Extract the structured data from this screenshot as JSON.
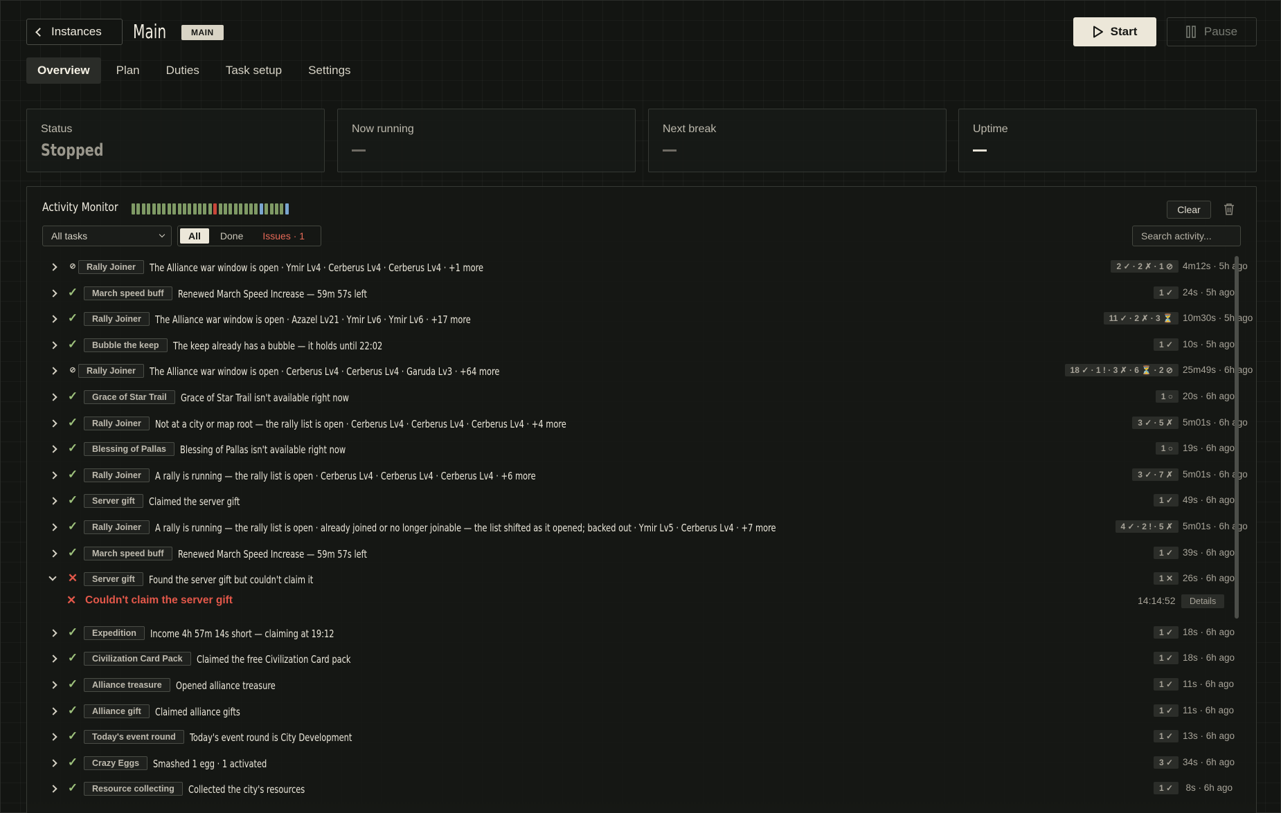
{
  "header": {
    "back_label": "Instances",
    "title": "Main",
    "badge": "MAIN",
    "start_label": "Start",
    "pause_label": "Pause"
  },
  "tabs": [
    {
      "label": "Overview",
      "active": true
    },
    {
      "label": "Plan"
    },
    {
      "label": "Duties"
    },
    {
      "label": "Task setup"
    },
    {
      "label": "Settings"
    }
  ],
  "stats": {
    "status_label": "Status",
    "status_value": "Stopped",
    "now_running_label": "Now running",
    "now_running_value": "—",
    "next_break_label": "Next break",
    "next_break_value": "—",
    "uptime_label": "Uptime",
    "uptime_value": "—"
  },
  "activity": {
    "title": "Activity Monitor",
    "clear_label": "Clear",
    "filter_selected": "All tasks",
    "seg_all": "All",
    "seg_done": "Done",
    "seg_issues": "Issues · 1",
    "search_placeholder": "Search activity...",
    "colors": {
      "ok": "#9dc17c",
      "error": "#e3584a",
      "info": "#7aa5cf"
    },
    "spark": [
      "ok",
      "ok",
      "ok",
      "ok",
      "ok",
      "ok",
      "ok",
      "ok",
      "ok",
      "ok",
      "ok",
      "ok",
      "ok",
      "ok",
      "ok",
      "ok",
      "error",
      "ok",
      "ok",
      "ok",
      "ok",
      "ok",
      "ok",
      "ok",
      "ok",
      "info",
      "ok",
      "ok",
      "ok",
      "ok",
      "info"
    ],
    "rows": [
      {
        "status": "skip",
        "tag": "Rally Joiner",
        "msg": "The Alliance war window is open · Ymir Lv4 · Cerberus Lv4 · Cerberus Lv4 · +1 more",
        "count": "2 ✓ · 2 ✗ · 1 ⊘",
        "time": "4m12s · 5h ago"
      },
      {
        "status": "ok",
        "tag": "March speed buff",
        "msg": "Renewed March Speed Increase — 59m 57s left",
        "count": "1 ✓",
        "time": "24s · 5h ago"
      },
      {
        "status": "ok",
        "tag": "Rally Joiner",
        "msg": "The Alliance war window is open · Azazel Lv21 · Ymir Lv6 · Ymir Lv6 · +17 more",
        "count": "11 ✓ · 2 ✗ · 3 ⏳",
        "time": "10m30s · 5h ago"
      },
      {
        "status": "ok",
        "tag": "Bubble the keep",
        "msg": "The keep already has a bubble — it holds until 22:02",
        "count": "1 ✓",
        "time": "10s · 5h ago"
      },
      {
        "status": "skip",
        "tag": "Rally Joiner",
        "msg": "The Alliance war window is open · Cerberus Lv4 · Cerberus Lv4 · Garuda Lv3 · +64 more",
        "count": "18 ✓ · 1 ! · 3 ✗ · 6 ⏳ · 2 ⊘",
        "time": "25m49s · 6h ago"
      },
      {
        "status": "ok",
        "tag": "Grace of Star Trail",
        "msg": "Grace of Star Trail isn't available right now",
        "count": "1 ○",
        "time": "20s · 6h ago"
      },
      {
        "status": "ok",
        "tag": "Rally Joiner",
        "msg": "Not at a city or map root — the rally list is open · Cerberus Lv4 · Cerberus Lv4 · Cerberus Lv4 · +4 more",
        "count": "3 ✓ · 5 ✗",
        "time": "5m01s · 6h ago"
      },
      {
        "status": "ok",
        "tag": "Blessing of Pallas",
        "msg": "Blessing of Pallas isn't available right now",
        "count": "1 ○",
        "time": "19s · 6h ago"
      },
      {
        "status": "ok",
        "tag": "Rally Joiner",
        "msg": "A rally is running — the rally list is open · Cerberus Lv4 · Cerberus Lv4 · Cerberus Lv4 · +6 more",
        "count": "3 ✓ · 7 ✗",
        "time": "5m01s · 6h ago"
      },
      {
        "status": "ok",
        "tag": "Server gift",
        "msg": "Claimed the server gift",
        "count": "1 ✓",
        "time": "49s · 6h ago"
      },
      {
        "status": "ok",
        "tag": "Rally Joiner",
        "msg": "A rally is running — the rally list is open · already joined or no longer joinable — the list shifted as it opened; backed out · Ymir Lv5 · Cerberus Lv4 · +7 more",
        "count": "4 ✓ · 2 ! · 5 ✗",
        "time": "5m01s · 6h ago"
      },
      {
        "status": "ok",
        "tag": "March speed buff",
        "msg": "Renewed March Speed Increase — 59m 57s left",
        "count": "1 ✓",
        "time": "39s · 6h ago"
      },
      {
        "status": "err",
        "expanded": true,
        "tag": "Server gift",
        "msg": "Found the server gift but couldn't claim it",
        "count": "1 ✕",
        "time": "26s · 6h ago",
        "detail": {
          "msg": "Couldn't claim the server gift",
          "time": "14:14:52",
          "button": "Details"
        }
      },
      {
        "status": "ok",
        "tag": "Expedition",
        "msg": "Income 4h 57m 14s short — claiming at 19:12",
        "count": "1 ✓",
        "time": "18s · 6h ago"
      },
      {
        "status": "ok",
        "tag": "Civilization Card Pack",
        "msg": "Claimed the free Civilization Card pack",
        "count": "1 ✓",
        "time": "18s · 6h ago"
      },
      {
        "status": "ok",
        "tag": "Alliance treasure",
        "msg": "Opened alliance treasure",
        "count": "1 ✓",
        "time": "11s · 6h ago"
      },
      {
        "status": "ok",
        "tag": "Alliance gift",
        "msg": "Claimed alliance gifts",
        "count": "1 ✓",
        "time": "11s · 6h ago"
      },
      {
        "status": "ok",
        "tag": "Today's event round",
        "msg": "Today's event round is City Development",
        "count": "1 ✓",
        "time": "13s · 6h ago"
      },
      {
        "status": "ok",
        "tag": "Crazy Eggs",
        "msg": "Smashed 1 egg · 1 activated",
        "count": "3 ✓",
        "time": "34s · 6h ago"
      },
      {
        "status": "ok",
        "tag": "Resource collecting",
        "msg": "Collected the city's resources",
        "count": "1 ✓",
        "time": "8s · 6h ago"
      }
    ]
  }
}
